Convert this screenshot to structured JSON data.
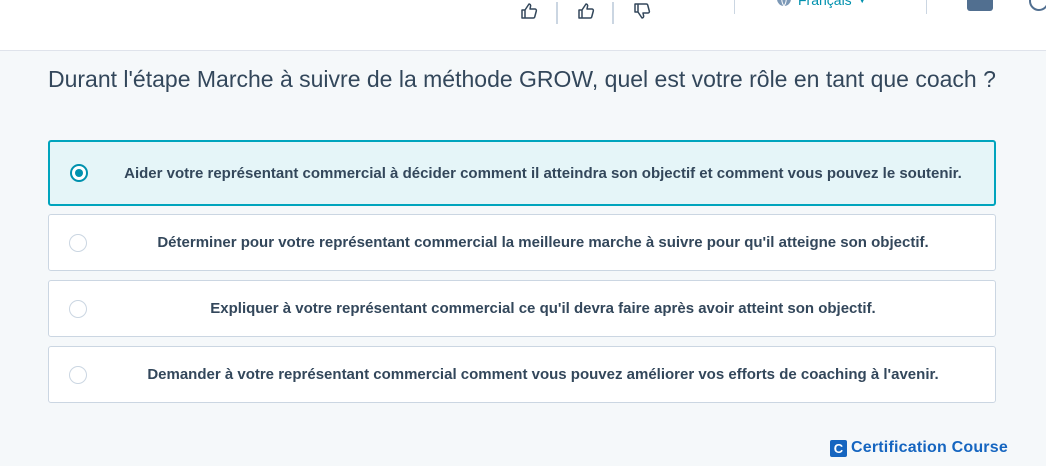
{
  "header": {
    "icons": [
      "thumbs-up-outline-icon",
      "thumbs-up-icon",
      "thumbs-down-icon",
      "globe-icon",
      "inbox-icon",
      "help-icon"
    ],
    "language_label": "Français"
  },
  "quiz": {
    "question": "Durant l'étape Marche à suivre de la méthode GROW, quel est votre rôle en tant que coach ?",
    "options": [
      {
        "label": "Aider votre représentant commercial à décider comment il atteindra son objectif et comment vous pouvez le soutenir.",
        "selected": true
      },
      {
        "label": "Déterminer pour votre représentant commercial la meilleure marche à suivre pour qu'il atteigne son objectif.",
        "selected": false
      },
      {
        "label": "Expliquer à votre représentant commercial ce qu'il devra faire après avoir atteint son objectif.",
        "selected": false
      },
      {
        "label": "Demander à votre représentant commercial comment vous pouvez améliorer vos efforts de coaching à l'avenir.",
        "selected": false
      }
    ]
  },
  "brand": {
    "logo_letter": "C",
    "name": "Certification Course"
  },
  "colors": {
    "accent": "#00a4bd",
    "selected_bg": "#e5f5f8",
    "brand": "#1565c0"
  }
}
